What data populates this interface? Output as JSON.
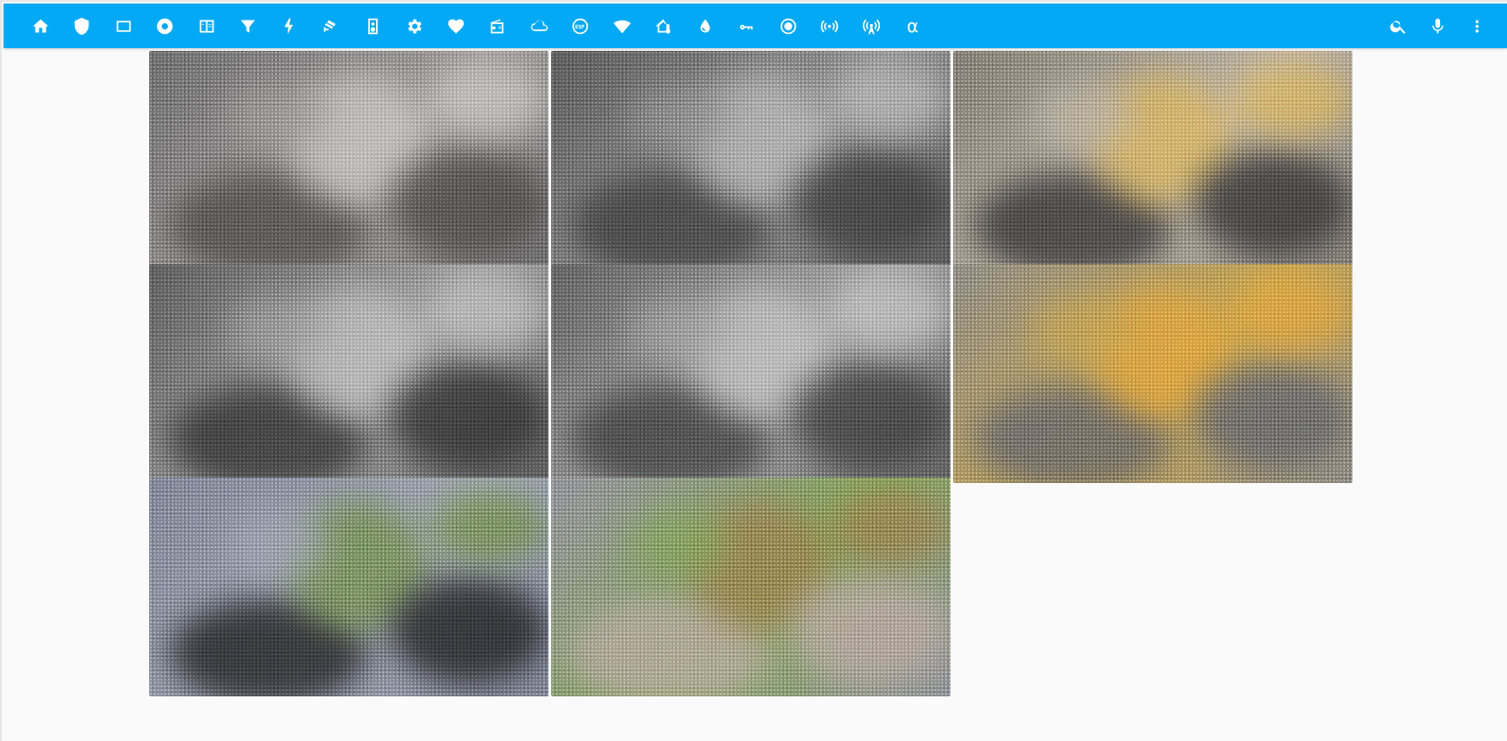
{
  "toolbar": {
    "background": "#03a9f4",
    "tabs": [
      {
        "icon": "home-icon"
      },
      {
        "icon": "shield-icon"
      },
      {
        "icon": "monitor-icon"
      },
      {
        "icon": "record-icon"
      },
      {
        "icon": "calendar-icon"
      },
      {
        "icon": "filter-icon"
      },
      {
        "icon": "lightning-icon"
      },
      {
        "icon": "cctv-icon"
      },
      {
        "icon": "doorbell-icon"
      },
      {
        "icon": "gear-icon"
      },
      {
        "icon": "heart-pulse-icon"
      },
      {
        "icon": "radio-icon"
      },
      {
        "icon": "cloud-icon"
      },
      {
        "icon": "esp-icon"
      },
      {
        "icon": "wifi-alert-icon"
      },
      {
        "icon": "home-thermometer-icon"
      },
      {
        "icon": "water-icon"
      },
      {
        "icon": "key-icon"
      },
      {
        "icon": "radiobox-icon"
      },
      {
        "icon": "access-point-icon"
      },
      {
        "icon": "antenna-icon"
      },
      {
        "icon": "alpha-icon",
        "glyph": "α"
      }
    ],
    "actions": [
      {
        "icon": "search-icon"
      },
      {
        "icon": "microphone-icon"
      },
      {
        "icon": "more-vertical-icon"
      }
    ]
  },
  "cameras": [
    {
      "palette": [
        "#6b6b6b",
        "#9a9696",
        "#4a4646",
        "#c8c3c3"
      ]
    },
    {
      "palette": [
        "#5a5a5a",
        "#8c8c8c",
        "#3a3a3a",
        "#b5b5b5"
      ]
    },
    {
      "palette": [
        "#7e7a72",
        "#b9b0a0",
        "#2d2d30",
        "#d8b25a"
      ]
    },
    {
      "palette": [
        "#5c5c5c",
        "#9a9a9a",
        "#2c2c2c",
        "#bdbdbd"
      ]
    },
    {
      "palette": [
        "#606060",
        "#9e9e9e",
        "#3a3a3a",
        "#c0c0c0"
      ]
    },
    {
      "palette": [
        "#8a8780",
        "#c2a050",
        "#5b5f6a",
        "#e0a23c"
      ]
    },
    {
      "palette": [
        "#7c8292",
        "#9aa0ad",
        "#1a1a1a",
        "#6e8c4a"
      ]
    },
    {
      "palette": [
        "#8e8e96",
        "#7fa05a",
        "#b8a5a0",
        "#9a7a4e"
      ]
    }
  ]
}
